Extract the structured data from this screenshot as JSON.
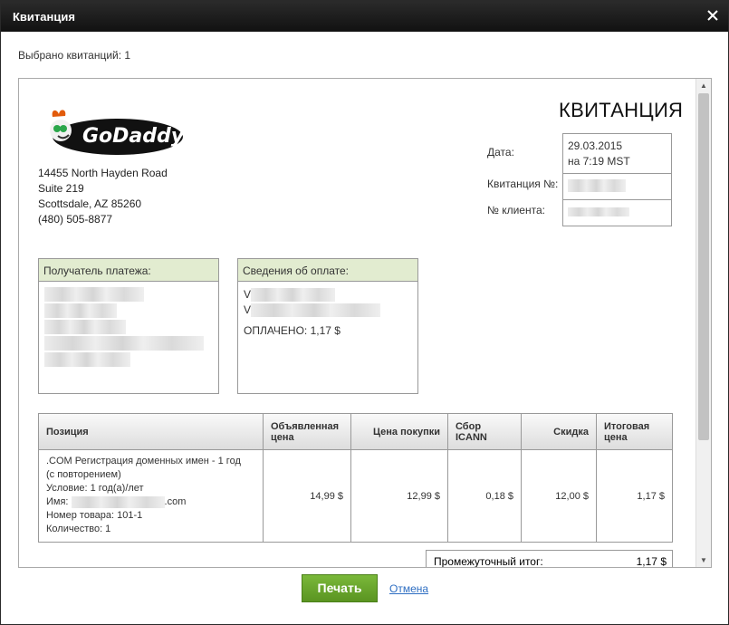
{
  "window": {
    "title": "Квитанция"
  },
  "selected_text": "Выбрано квитанций: 1",
  "receipt": {
    "title": "КВИТАНЦИЯ",
    "address": [
      "14455 North Hayden Road",
      "Suite 219",
      "Scottsdale, AZ 85260",
      "(480) 505-8877"
    ],
    "date_label": "Дата:",
    "date_value": "29.03.2015",
    "time_value": "на 7:19 MST",
    "receipt_no_label": "Квитанция №:",
    "client_no_label": "№ клиента:",
    "payee_header": "Получатель платежа:",
    "payment_header": "Сведения об оплате:",
    "payment_initial_1": "V",
    "payment_initial_2": "V",
    "paid_text": "ОПЛАЧЕНО: 1,17 $"
  },
  "table": {
    "headers": [
      "Позиция",
      "Объявленная цена",
      "Цена покупки",
      "Сбор ICANN",
      "Скидка",
      "Итоговая цена"
    ],
    "row": {
      "line1": ".COM Регистрация доменных имен - 1 год",
      "line2": "(с повторением)",
      "line3": "Условие: 1 год(а)/лет",
      "line4_prefix": "Имя:",
      "line4_suffix": ".com",
      "line5": "Номер товара: 101-1",
      "line6": "Количество: 1",
      "values": [
        "14,99 $",
        "12,99 $",
        "0,18 $",
        "12,00 $",
        "1,17 $"
      ]
    }
  },
  "subtotal": {
    "label": "Промежуточный итог:",
    "value": "1,17 $"
  },
  "buttons": {
    "print": "Печать",
    "cancel": "Отмена"
  },
  "logo_text": "GoDaddy",
  "colors": {
    "accent": "#5a9421",
    "header_green": "#e2ecd0",
    "link": "#2e6ec2"
  }
}
